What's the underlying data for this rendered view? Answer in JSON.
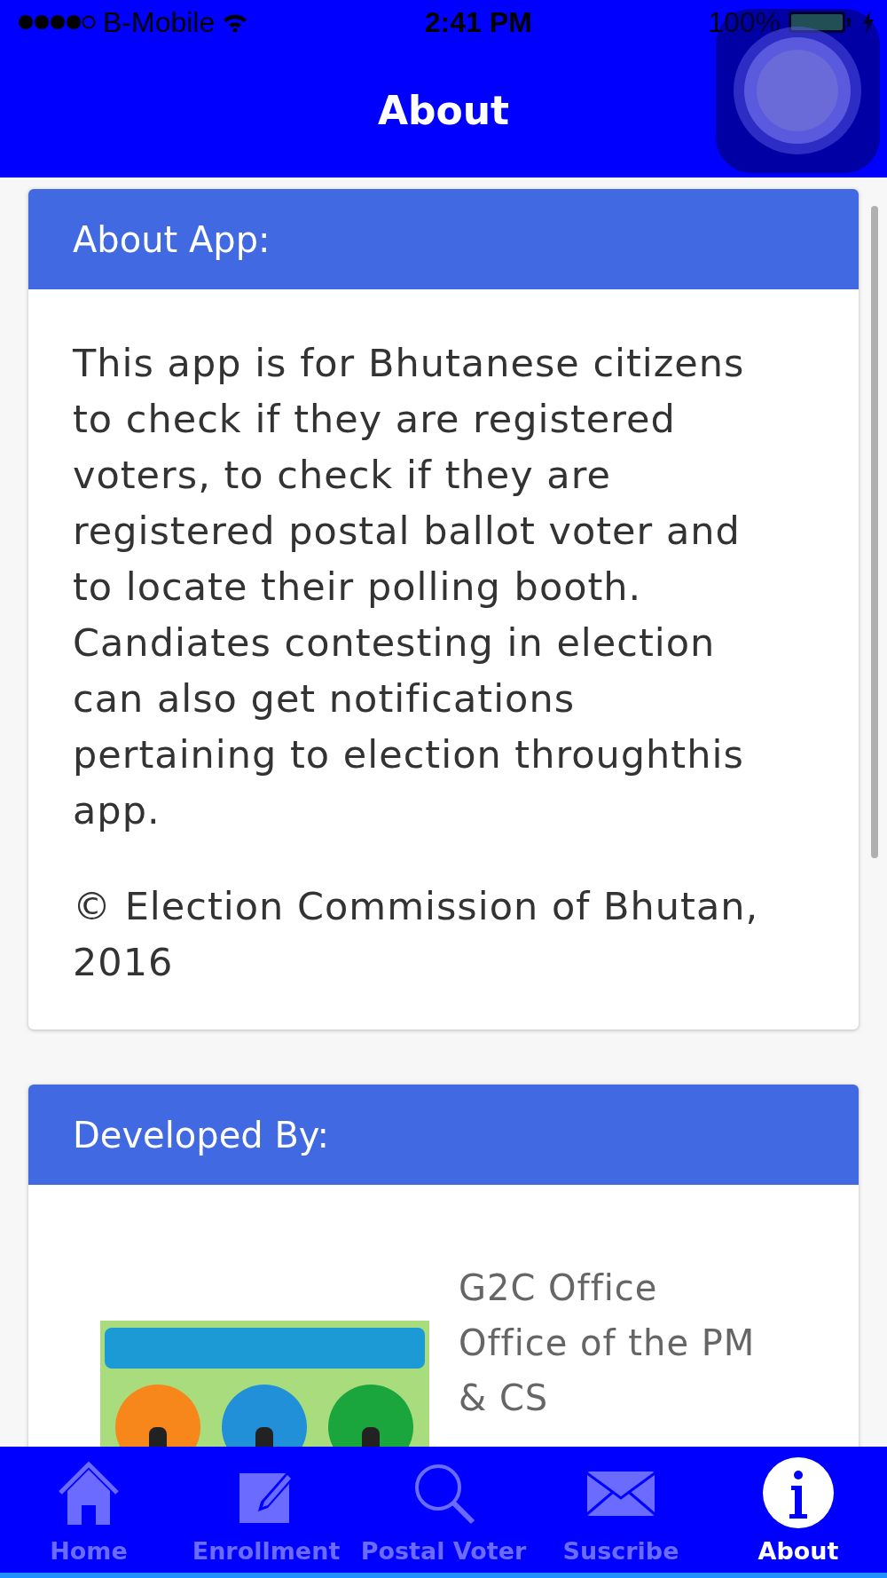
{
  "status_bar": {
    "carrier": "B-Mobile",
    "time": "2:41 PM",
    "battery": "100%"
  },
  "nav_bar": {
    "title": "About"
  },
  "cards": [
    {
      "title": "About App:",
      "paragraphs": [
        "This app is for Bhutanese citizens to check if they are registered voters, to check if they are registered postal ballot voter and to locate their polling booth. Candiates contesting in election can also get notifications pertaining to election throughthis app.",
        "© Election Commission of Bhutan, 2016"
      ]
    },
    {
      "title": "Developed By:",
      "lines": [
        "G2C Office",
        "Office of the PM",
        "& CS"
      ]
    }
  ],
  "tabs": [
    {
      "label": "Home",
      "selected": false
    },
    {
      "label": "Enrollment",
      "selected": false
    },
    {
      "label": "Postal Voter",
      "selected": false
    },
    {
      "label": "Suscribe",
      "selected": false
    },
    {
      "label": "About",
      "selected": true
    }
  ]
}
